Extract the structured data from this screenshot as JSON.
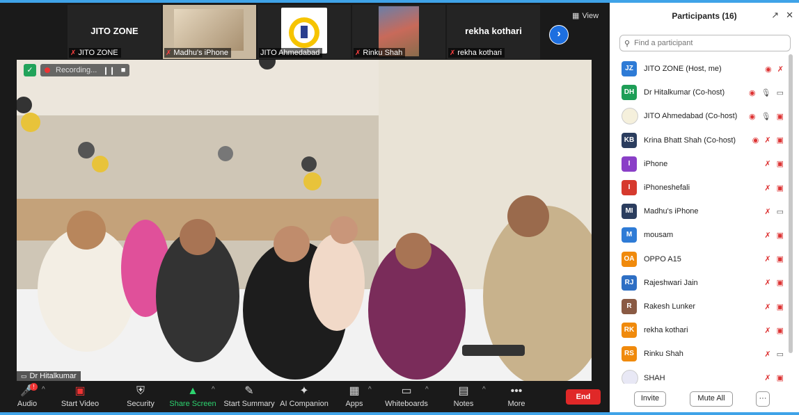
{
  "gallery": {
    "tiles": [
      {
        "name": "JITO ZONE",
        "label": "JITO ZONE",
        "muted": true
      },
      {
        "name": "",
        "label": "Madhu's iPhone",
        "muted": true
      },
      {
        "name": "",
        "label": "JITO Ahmedabad",
        "muted": false
      },
      {
        "name": "",
        "label": "Rinku Shah",
        "muted": true
      },
      {
        "name": "rekha kothari",
        "label": "rekha kothari",
        "muted": true
      }
    ],
    "view_label": "View"
  },
  "recording": {
    "label": "Recording..."
  },
  "main_video": {
    "speaker": "Dr Hitalkumar"
  },
  "toolbar": {
    "audio": "Audio",
    "start_video": "Start Video",
    "security": "Security",
    "share_screen": "Share Screen",
    "start_summary": "Start Summary",
    "ai_companion": "AI Companion",
    "apps": "Apps",
    "whiteboards": "Whiteboards",
    "notes": "Notes",
    "more": "More",
    "end": "End",
    "audio_badge": "!"
  },
  "participants": {
    "title": "Participants (16)",
    "search_placeholder": "Find a participant",
    "list": [
      {
        "initials": "JZ",
        "name": "JITO ZONE (Host, me)",
        "color": "#2e7bd6"
      },
      {
        "initials": "DH",
        "name": "Dr Hitalkumar (Co-host)",
        "color": "#1e9e57"
      },
      {
        "initials": "",
        "name": "JITO Ahmedabad (Co-host)",
        "color": "#f5f0dc"
      },
      {
        "initials": "KB",
        "name": "Krina Bhatt Shah (Co-host)",
        "color": "#2b3d5e"
      },
      {
        "initials": "I",
        "name": "iPhone",
        "color": "#8a3fc7"
      },
      {
        "initials": "I",
        "name": "iPhoneshefali",
        "color": "#d63a2e"
      },
      {
        "initials": "MI",
        "name": "Madhu's iPhone",
        "color": "#2b3d5e"
      },
      {
        "initials": "M",
        "name": "mousam",
        "color": "#2e7bd6"
      },
      {
        "initials": "OA",
        "name": "OPPO A15",
        "color": "#f08a0c"
      },
      {
        "initials": "RJ",
        "name": "Rajeshwari Jain",
        "color": "#2e6fc4"
      },
      {
        "initials": "R",
        "name": "Rakesh Lunker",
        "color": "#8a5a44"
      },
      {
        "initials": "RK",
        "name": "rekha kothari",
        "color": "#f08a0c"
      },
      {
        "initials": "RS",
        "name": "Rinku Shah",
        "color": "#f08a0c"
      },
      {
        "initials": "",
        "name": "SHAH",
        "color": "#e8e8f5"
      }
    ],
    "invite": "Invite",
    "mute_all": "Mute All",
    "more": "···"
  }
}
